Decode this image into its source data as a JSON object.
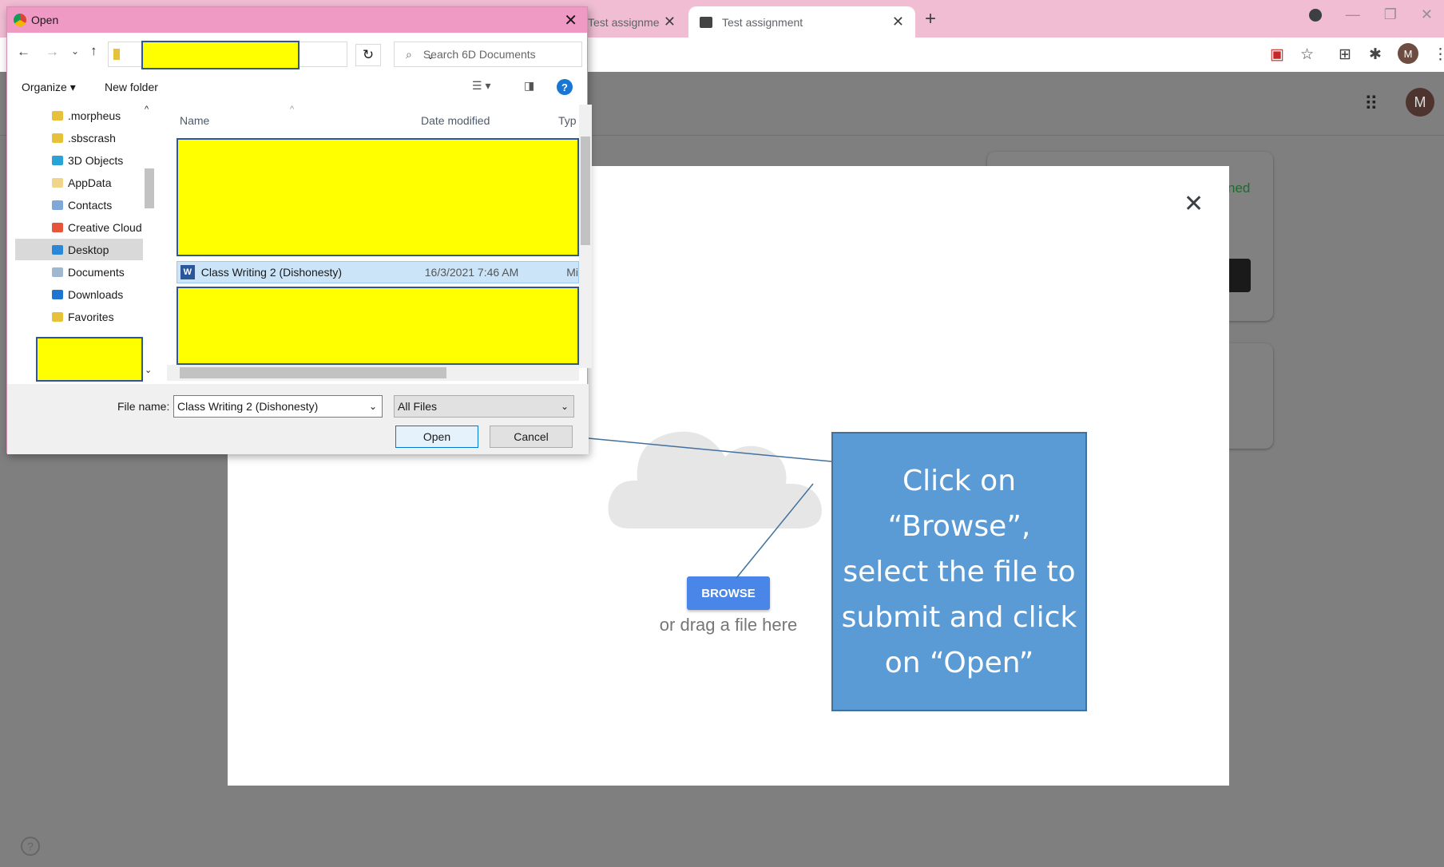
{
  "browser": {
    "tab1_title": "Test assignme",
    "tab2_title": "Test assignment",
    "new_tab": "+",
    "avatar_letter": "M"
  },
  "page": {
    "avatar_letter": "M",
    "card_text": "ned",
    "help": "?"
  },
  "dialog": {
    "title": "Open",
    "search_placeholder": "Search 6D Documents",
    "organize": "Organize ▾",
    "new_folder": "New folder",
    "help": "?",
    "nav_items": [
      {
        "label": ".morpheus",
        "color": "#e8c13a"
      },
      {
        "label": ".sbscrash",
        "color": "#e8c13a"
      },
      {
        "label": "3D Objects",
        "color": "#29a3d6"
      },
      {
        "label": "AppData",
        "color": "#f0d58a"
      },
      {
        "label": "Contacts",
        "color": "#7fa7d9"
      },
      {
        "label": "Creative Cloud",
        "color": "#e8543a"
      },
      {
        "label": "Desktop",
        "color": "#2b88d8"
      },
      {
        "label": "Documents",
        "color": "#9fb7cf"
      },
      {
        "label": "Downloads",
        "color": "#1e74d1"
      },
      {
        "label": "Favorites",
        "color": "#e8c13a"
      }
    ],
    "columns": {
      "name": "Name",
      "date": "Date modified",
      "type": "Typ"
    },
    "selected_file": {
      "icon": "W",
      "name": "Class Writing 2 (Dishonesty)",
      "date": "16/3/2021 7:46 AM",
      "type": "Mi"
    },
    "file_name_label": "File name:",
    "file_name_value": "Class Writing 2 (Dishonesty)",
    "filter": "All Files",
    "open": "Open",
    "cancel": "Cancel"
  },
  "upload": {
    "browse": "BROWSE",
    "drag_text": "or drag a file here"
  },
  "callout": {
    "text": "Click on “Browse”, select the file to submit and click on “Open”"
  },
  "colors": {
    "redaction": "#ffff00",
    "callout": "#5b9bd5",
    "browse_button": "#4a86e8"
  }
}
